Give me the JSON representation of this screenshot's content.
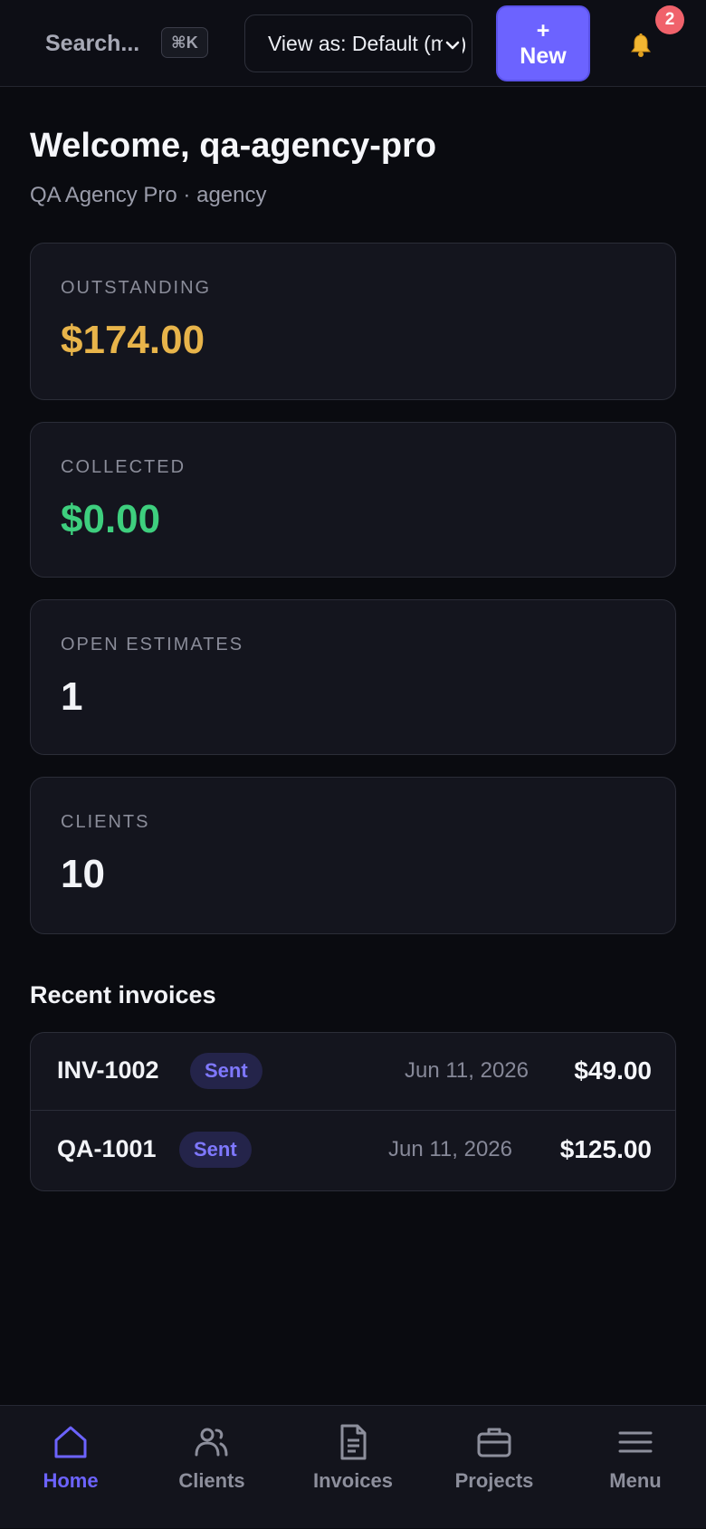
{
  "header": {
    "search_label": "Search...",
    "search_shortcut": "⌘K",
    "view_as": "View as: Default (me)",
    "new_button": {
      "plus": "+",
      "label": "New"
    },
    "notifications_count": "2"
  },
  "welcome": {
    "title": "Welcome, qa-agency-pro",
    "subtitle": "QA Agency Pro · agency"
  },
  "stats": [
    {
      "label": "OUTSTANDING",
      "value": "$174.00",
      "color": "#e8b44a"
    },
    {
      "label": "COLLECTED",
      "value": "$0.00",
      "color": "#3ecf7e"
    },
    {
      "label": "OPEN ESTIMATES",
      "value": "1",
      "color": "#f2f3f7"
    },
    {
      "label": "CLIENTS",
      "value": "10",
      "color": "#f2f3f7"
    }
  ],
  "recent_invoices": {
    "title": "Recent invoices",
    "rows": [
      {
        "number": "INV-1002",
        "status": "Sent",
        "date": "Jun 11, 2026",
        "amount": "$49.00"
      },
      {
        "number": "QA-1001",
        "status": "Sent",
        "date": "Jun 11, 2026",
        "amount": "$125.00"
      }
    ]
  },
  "bottom_nav": [
    {
      "label": "Home",
      "icon": "home-icon",
      "active": true
    },
    {
      "label": "Clients",
      "icon": "users-icon",
      "active": false
    },
    {
      "label": "Invoices",
      "icon": "document-icon",
      "active": false
    },
    {
      "label": "Projects",
      "icon": "briefcase-icon",
      "active": false
    },
    {
      "label": "Menu",
      "icon": "hamburger-menu-icon",
      "active": false
    }
  ]
}
